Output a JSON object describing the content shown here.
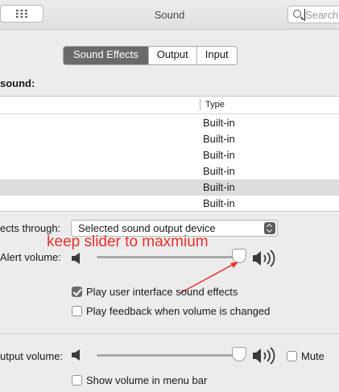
{
  "window": {
    "title": "Sound"
  },
  "search": {
    "placeholder": "Search"
  },
  "tabs": [
    {
      "label": "Sound Effects",
      "active": true
    },
    {
      "label": "Output",
      "active": false
    },
    {
      "label": "Input",
      "active": false
    }
  ],
  "alert_heading": "sound:",
  "table": {
    "column_type": "Type",
    "rows": [
      {
        "type": "Built-in",
        "selected": false
      },
      {
        "type": "Built-in",
        "selected": false
      },
      {
        "type": "Built-in",
        "selected": false
      },
      {
        "type": "Built-in",
        "selected": false
      },
      {
        "type": "Built-in",
        "selected": true
      },
      {
        "type": "Built-in",
        "selected": false
      }
    ]
  },
  "play_through": {
    "label": "ects through:",
    "value": "Selected sound output device"
  },
  "alert_volume": {
    "label": "Alert volume:",
    "level": 1.0
  },
  "annotation": {
    "text": "keep slider to maxmium",
    "color": "#e8302a"
  },
  "options": {
    "ui_sound_effects": {
      "label": "Play user interface sound effects",
      "checked": true
    },
    "volume_feedback": {
      "label": "Play feedback when volume is changed",
      "checked": false
    }
  },
  "output_volume": {
    "label": "utput volume:",
    "level": 1.0
  },
  "mute": {
    "label": "Mute",
    "checked": false
  },
  "menu_bar": {
    "label": "Show volume in menu bar",
    "checked": false
  },
  "icons": [
    "grid-icon",
    "search-icon",
    "speaker-low-icon",
    "speaker-high-icon",
    "checkmark-icon"
  ]
}
